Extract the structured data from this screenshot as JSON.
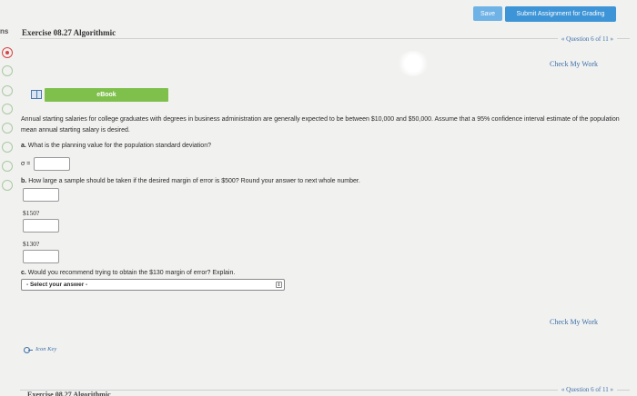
{
  "topbar": {
    "save_label": "Save",
    "submit_label": "Submit Assignment for Grading"
  },
  "rail": {
    "edge_label": "ns"
  },
  "header": {
    "exercise_title": "Exercise 08.27 Algorithmic",
    "question_nav": "« Question 6 of 11 »",
    "check_work": "Check My Work"
  },
  "ebook": {
    "label": "eBook"
  },
  "problem": {
    "text": "Annual starting salaries for college graduates with degrees in business administration are generally expected to be between $10,000 and $50,000. Assume that a 95% confidence interval estimate of the population mean annual starting salary is desired."
  },
  "questions": {
    "a": {
      "prefix": "a.",
      "text": "What is the planning value for the population standard deviation?",
      "sigma_label": "σ ="
    },
    "b": {
      "prefix": "b.",
      "text": "How large a sample should be taken if the desired margin of error is $500? Round your answer to next whole number.",
      "sub": [
        "$150?",
        "$130?"
      ]
    },
    "c": {
      "prefix": "c.",
      "text": "Would you recommend trying to obtain the $130 margin of error? Explain.",
      "select_placeholder": "- Select your answer -",
      "select_arrow": "⇕"
    }
  },
  "footer": {
    "check_work": "Check My Work",
    "icon_key": "Icon Key",
    "question_nav": "« Question 6 of 11 »",
    "exercise_title": "Exercise 08.27 Algorithmic"
  }
}
